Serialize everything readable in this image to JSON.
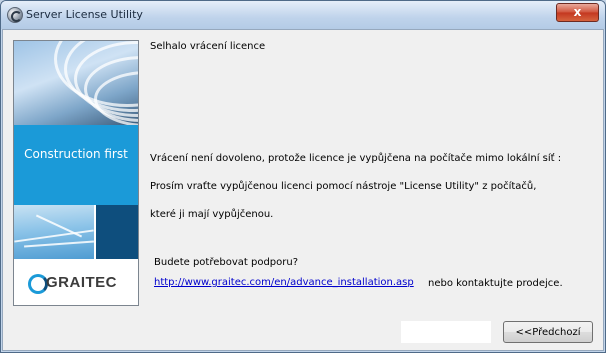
{
  "window": {
    "title": "Server License Utility",
    "close_label": "x"
  },
  "sidebar": {
    "tagline": "Construction first",
    "logo_text": "GRAITEC"
  },
  "content": {
    "headline": "Selhalo vrácení licence",
    "body_lines": [
      "Vrácení není dovoleno, protože licence je vypůjčena na počítače mimo lokální síť :",
      "Prosím vraťte vypůjčenou licenci pomocí nástroje \"License Utility\" z počítačů,",
      "které ji mají vypůjčenou."
    ],
    "support_question": "Budete potřebovat podporu?",
    "support_link": "http://www.graitec.com/en/advance_installation.asp",
    "contact_text": "nebo kontaktujte prodejce."
  },
  "buttons": {
    "back_label": "<<Předchozí"
  },
  "colors": {
    "brand_blue": "#1b9ad8",
    "brand_navy": "#0e4e7d",
    "link": "#0000cc",
    "close_red": "#c3361f"
  }
}
